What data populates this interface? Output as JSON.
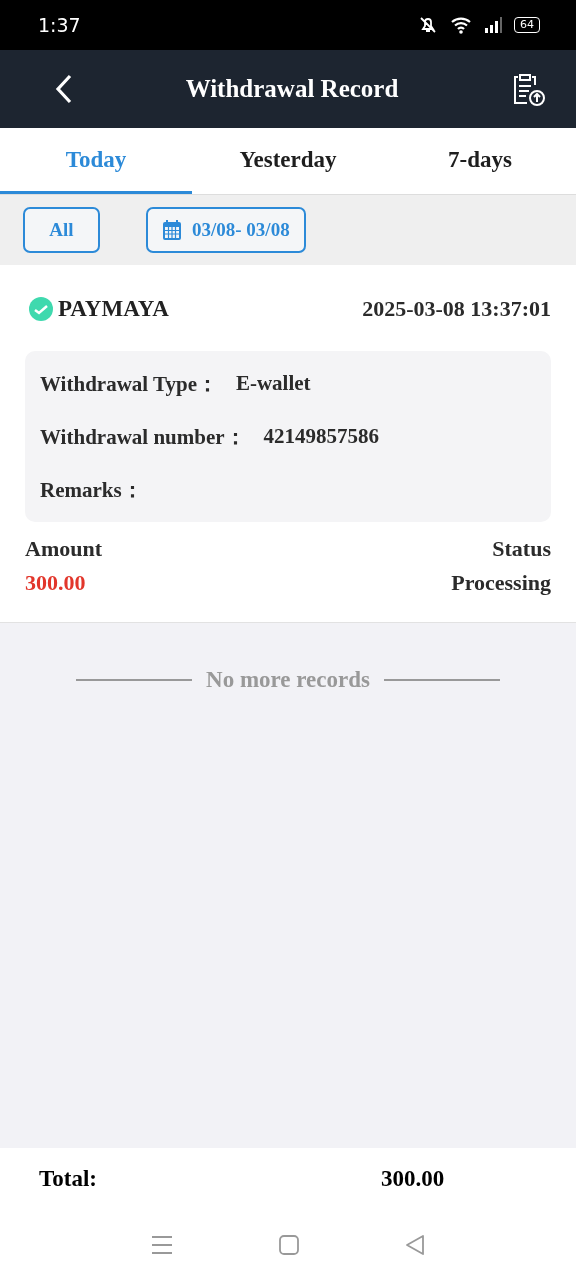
{
  "status_bar": {
    "time": "1:37",
    "battery": "64"
  },
  "header": {
    "title": "Withdrawal Record"
  },
  "tabs": [
    {
      "label": "Today",
      "selected": true
    },
    {
      "label": "Yesterday",
      "selected": false
    },
    {
      "label": "7-days",
      "selected": false
    }
  ],
  "filters": {
    "all_label": "All",
    "date_range": "03/08- 03/08"
  },
  "records": [
    {
      "provider": "PAYMAYA",
      "datetime": "2025-03-08 13:37:01",
      "details": [
        {
          "label": "Withdrawal Type：",
          "value": "E-wallet"
        },
        {
          "label": "Withdrawal number：",
          "value": "42149857586"
        },
        {
          "label": "Remarks："
        }
      ],
      "amount_label": "Amount",
      "amount": "300.00",
      "status_label": "Status",
      "status": "Processing"
    }
  ],
  "end_note": "No more records",
  "footer": {
    "total_label": "Total:",
    "total": "300.00"
  }
}
